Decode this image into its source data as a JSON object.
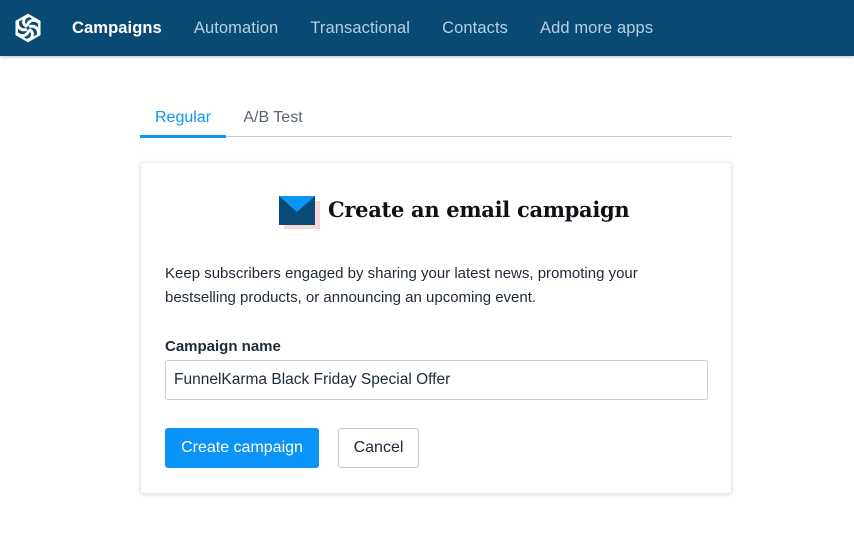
{
  "nav": {
    "logo": "sendinblue-logo-icon",
    "items": [
      {
        "label": "Campaigns",
        "active": true
      },
      {
        "label": "Automation",
        "active": false
      },
      {
        "label": "Transactional",
        "active": false
      },
      {
        "label": "Contacts",
        "active": false
      },
      {
        "label": "Add more apps",
        "active": false
      }
    ]
  },
  "tabs": [
    {
      "label": "Regular",
      "active": true
    },
    {
      "label": "A/B Test",
      "active": false
    }
  ],
  "card": {
    "icon": "envelope-icon",
    "title": "Create an email campaign",
    "description": "Keep subscribers engaged by sharing your latest news, promoting your bestselling products, or announcing an upcoming event.",
    "field_label": "Campaign name",
    "field_value": "FunnelKarma Black Friday Special Offer",
    "create_label": "Create campaign",
    "cancel_label": "Cancel"
  },
  "colors": {
    "nav_bg": "#084a73",
    "accent": "#0c93f7",
    "envelope_dark": "#0a4a78",
    "envelope_flap": "#0b96f5",
    "envelope_shadow": "#f9d6d8"
  }
}
